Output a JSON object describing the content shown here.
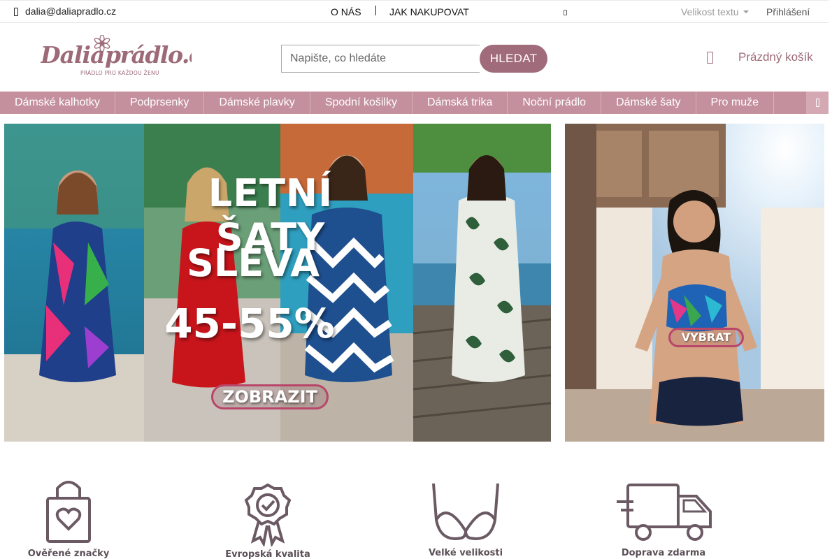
{
  "topbar": {
    "email": "dalia@daliapradlo.cz",
    "about": "O NÁS",
    "how_to_buy": "JAK NAKUPOVAT",
    "text_size": "Velikost textu",
    "login": "Přihlášení"
  },
  "header": {
    "logo": {
      "brand": "Dalia prádlo.cz",
      "tagline": "PRÁDLO PRO KAŽDOU ŽENU"
    },
    "search": {
      "placeholder": "Napište, co hledáte",
      "button": "HLEDAT"
    },
    "cart": {
      "label": "Prázdný košík",
      "icon": "shopping-bag-icon"
    }
  },
  "nav": {
    "items": [
      {
        "label": "Dámské kalhotky"
      },
      {
        "label": "Podprsenky"
      },
      {
        "label": "Dámské plavky"
      },
      {
        "label": "Spodní košilky"
      },
      {
        "label": "Dámská trika"
      },
      {
        "label": "Noční prádlo"
      },
      {
        "label": "Dámské šaty"
      },
      {
        "label": "Pro muže"
      }
    ],
    "more_icon": "menu-icon"
  },
  "banners": {
    "main": {
      "headline": "LETNÍ ŠATY",
      "discount_label": "SLEVA",
      "discount_value": "45-55%",
      "cta": "ZOBRAZIT"
    },
    "side": {
      "cta": "VYBRAT"
    }
  },
  "features": [
    {
      "label": "Ověřené značky",
      "icon": "shopping-bag-heart-icon"
    },
    {
      "label": "Evropská kvalita",
      "icon": "quality-badge-icon"
    },
    {
      "label": "Velké velikosti",
      "icon": "bra-icon"
    },
    {
      "label": "Doprava zdarma",
      "icon": "delivery-truck-icon"
    }
  ],
  "colors": {
    "accent": "#a06b7a",
    "nav_background": "#c4909e",
    "cart_text": "#9d6b78",
    "feature_icon": "#6b5a63"
  }
}
